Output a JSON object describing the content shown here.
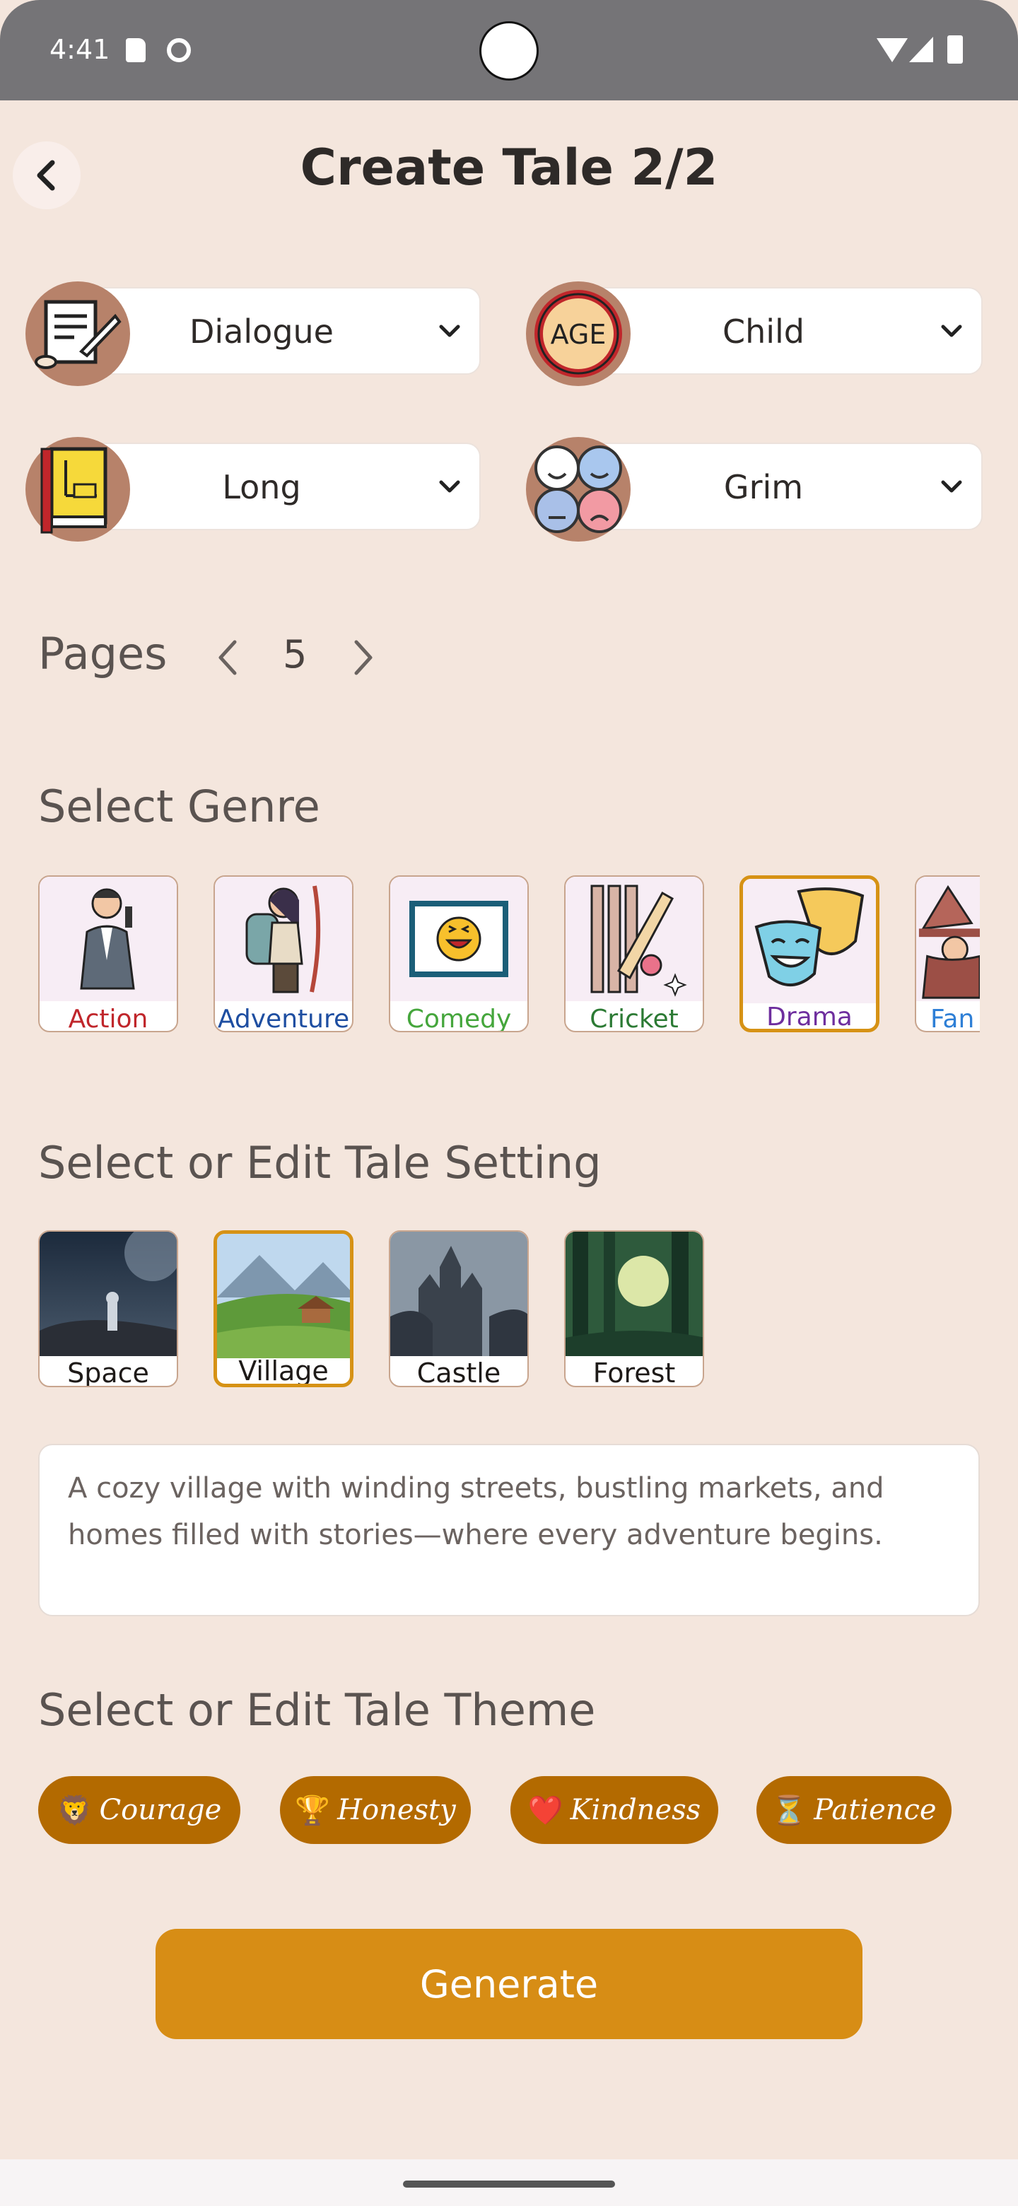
{
  "status_bar": {
    "time": "4:41"
  },
  "header": {
    "title": "Create Tale 2/2"
  },
  "dropdowns": [
    {
      "label": "Dialogue",
      "icon": "scroll-quill-icon"
    },
    {
      "label": "Child",
      "icon": "age-icon"
    },
    {
      "label": "Long",
      "icon": "book-ruler-icon"
    },
    {
      "label": "Grim",
      "icon": "mood-faces-icon"
    }
  ],
  "pages": {
    "label": "Pages",
    "value": "5"
  },
  "genre": {
    "title": "Select Genre",
    "items": [
      {
        "label": "Action",
        "color": "#C0262B",
        "icon": "spy-agent-icon"
      },
      {
        "label": "Adventure",
        "color": "#1E4EA1",
        "icon": "hiker-icon"
      },
      {
        "label": "Comedy",
        "color": "#45A63C",
        "icon": "laughing-face-icon"
      },
      {
        "label": "Cricket",
        "color": "#2C7A34",
        "icon": "cricket-bat-icon"
      },
      {
        "label": "Drama",
        "color": "#6E2E9E",
        "icon": "theatre-masks-icon",
        "selected": true
      },
      {
        "label": "Fan",
        "color": "#2E7FD6",
        "icon": "wizard-icon"
      }
    ]
  },
  "setting": {
    "title": "Select or Edit Tale Setting",
    "items": [
      {
        "label": "Space"
      },
      {
        "label": "Village",
        "selected": true
      },
      {
        "label": "Castle"
      },
      {
        "label": "Forest"
      }
    ],
    "description": "A cozy village with winding streets, bustling markets, and homes filled with stories—where every adventure begins."
  },
  "theme": {
    "title": "Select or Edit Tale Theme",
    "chips": [
      {
        "emoji": "🦁",
        "label": "Courage"
      },
      {
        "emoji": "🏆",
        "label": "Honesty"
      },
      {
        "emoji": "❤️",
        "label": "Kindness"
      },
      {
        "emoji": "⏳",
        "label": "Patience"
      }
    ]
  },
  "generate_label": "Generate"
}
